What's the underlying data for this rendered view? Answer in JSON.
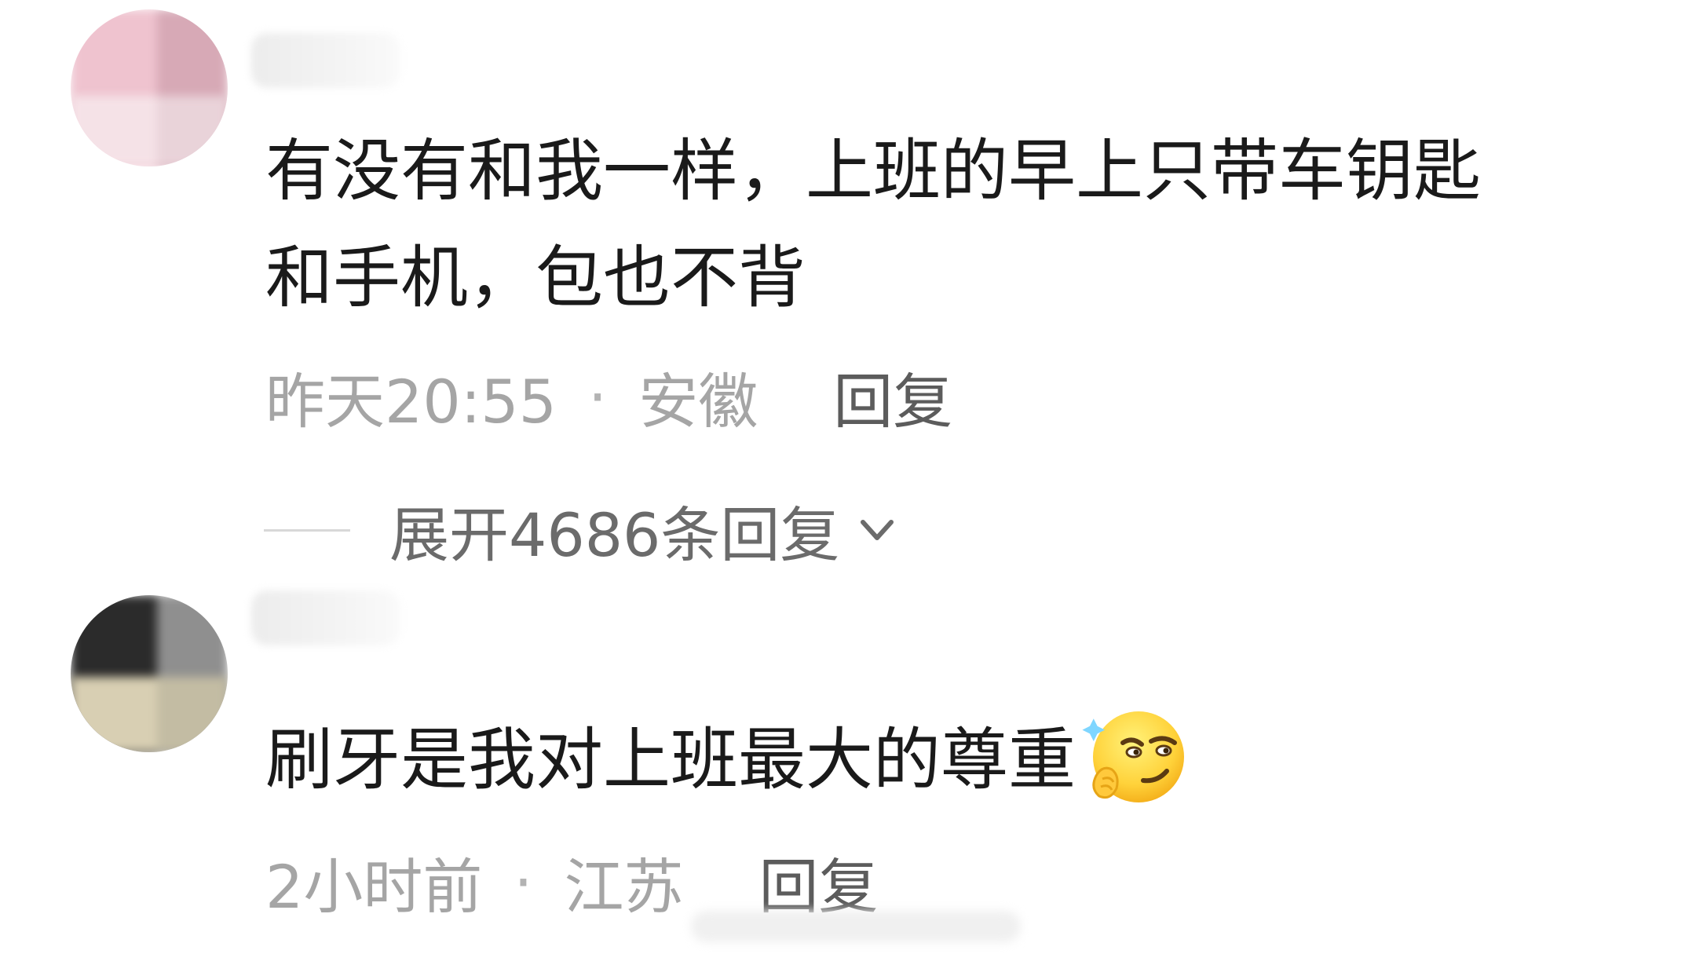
{
  "comments": [
    {
      "text_line1": "有没有和我一样，上班的早上只带车钥匙",
      "text_line2": "和手机，包也不背",
      "time": "昨天20:55",
      "separator": "·",
      "location": "安徽",
      "reply_label": "回复",
      "expand_label": "展开4686条回复",
      "avatar_colors": [
        "#f0c6d1",
        "#d9aab6",
        "#f4dde3",
        "#e8c8d0"
      ]
    },
    {
      "text": "刷牙是我对上班最大的尊重",
      "emoji": "smirk-emoji",
      "time": "2小时前",
      "separator": "·",
      "location": "江苏",
      "reply_label": "回复",
      "avatar_colors": [
        "#2a2a2a",
        "#9a9a9a",
        "#d9d1b6",
        "#c7c0a6"
      ]
    }
  ],
  "icons": {
    "expand": "chevron-down-icon"
  }
}
